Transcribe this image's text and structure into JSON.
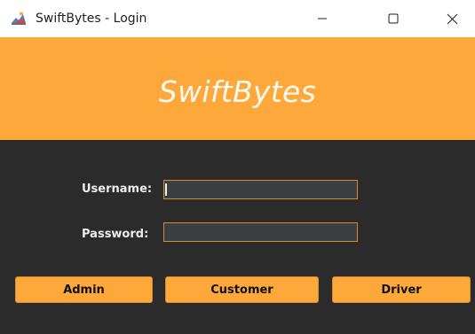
{
  "window": {
    "title": "SwiftBytes - Login",
    "controls": [
      "minimize-icon",
      "maximize-icon",
      "close-icon"
    ]
  },
  "banner": {
    "title": "SwiftBytes"
  },
  "form": {
    "username_label": "Username:",
    "username_value": "",
    "password_label": "Password:",
    "password_value": ""
  },
  "buttons": {
    "admin": "Admin",
    "customer": "Customer",
    "driver": "Driver"
  },
  "colors": {
    "accent": "#fca83a",
    "background": "#2b2b2b",
    "field_border": "#d68a2e"
  }
}
